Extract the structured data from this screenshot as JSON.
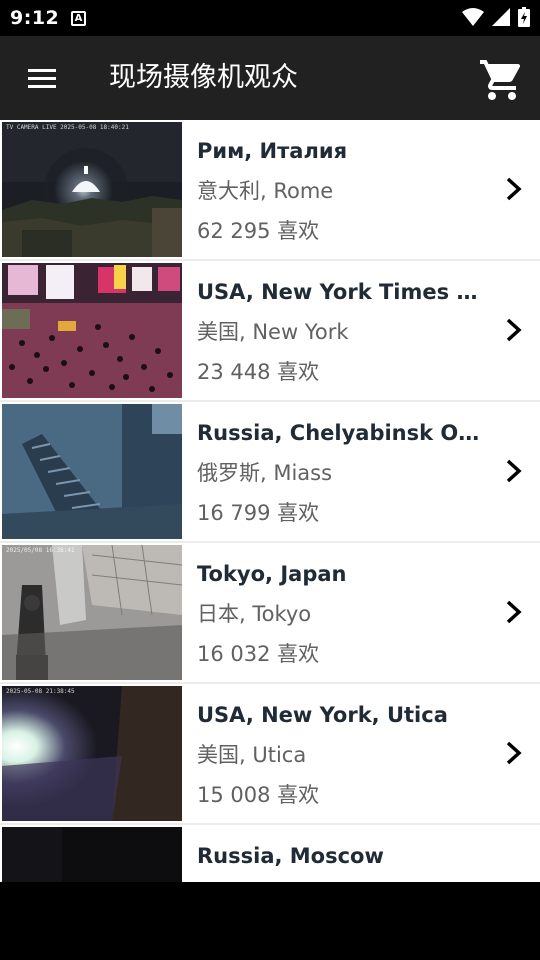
{
  "status": {
    "time": "9:12",
    "a_badge": "A"
  },
  "app_bar": {
    "title": "现场摄像机观众"
  },
  "cameras": [
    {
      "name": "Рим, Италия",
      "location": "意大利, Rome",
      "likes": "62 295 喜欢",
      "stamp": "TV CAMERA LIVE 2025-05-08 18:40:21"
    },
    {
      "name": "USA, New York Times Square",
      "location": "美国, New York",
      "likes": "23 448 喜欢",
      "stamp": ""
    },
    {
      "name": "Russia, Chelyabinsk Oblast",
      "location": "俄罗斯, Miass",
      "likes": "16 799 喜欢",
      "stamp": ""
    },
    {
      "name": "Tokyo, Japan",
      "location": "日本, Tokyo",
      "likes": "16 032 喜欢",
      "stamp": "2025/05/08 16:38:41"
    },
    {
      "name": "USA, New York, Utica",
      "location": "美国, Utica",
      "likes": "15 008 喜欢",
      "stamp": "2025-05-08 21:38:45"
    },
    {
      "name": "Russia, Moscow",
      "location": "",
      "likes": "",
      "stamp": ""
    }
  ]
}
